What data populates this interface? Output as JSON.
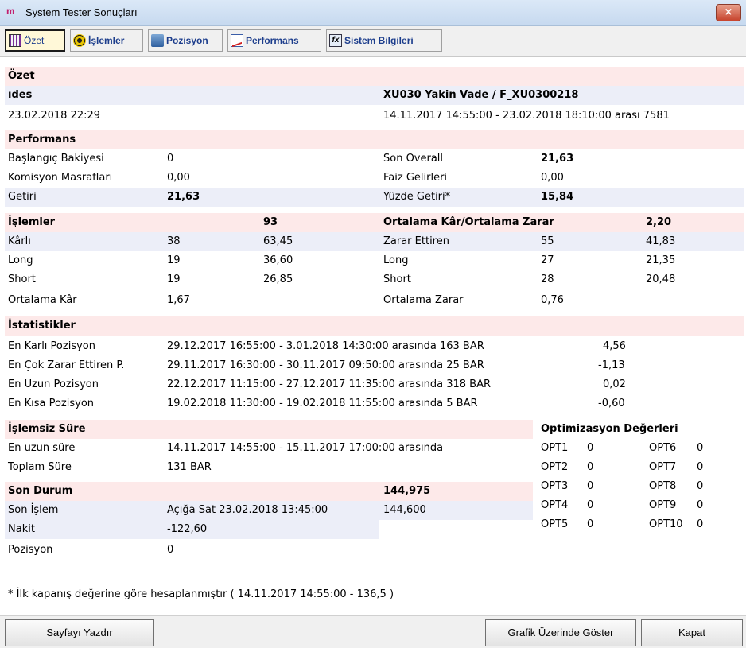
{
  "window": {
    "title": "System Tester Sonuçları",
    "close_label": "×",
    "app_icon_text": "m"
  },
  "tabs": [
    {
      "label": "Özet",
      "active": true
    },
    {
      "label": "İşlemler",
      "active": false
    },
    {
      "label": "Pozisyon",
      "active": false
    },
    {
      "label": "Performans",
      "active": false
    },
    {
      "label": "Sistem Bilgileri",
      "active": false
    }
  ],
  "summary": {
    "section_title": "Özet",
    "name": "ıdes",
    "symbol": "XU030 Yakin Vade / F_XU0300218",
    "date": "23.02.2018 22:29",
    "range": "14.11.2017 14:55:00 - 23.02.2018 18:10:00 arası 7581"
  },
  "performance": {
    "title": "Performans",
    "rows": [
      {
        "l1": "Başlangıç Bakiyesi",
        "v1": "0",
        "l2": "Son Overall",
        "v2": "21,63"
      },
      {
        "l1": "Komisyon Masrafları",
        "v1": "0,00",
        "l2": "Faiz Gelirleri",
        "v2": "0,00"
      },
      {
        "l1": "Getiri",
        "v1": "21,63",
        "l2": "Yüzde Getiri*",
        "v2": "15,84"
      }
    ]
  },
  "trades": {
    "title": "İşlemler",
    "total": "93",
    "ratio_label": "Ortalama Kâr/Ortalama Zarar",
    "ratio_value": "2,20",
    "rows": [
      {
        "l1": "Kârlı",
        "c1": "38",
        "p1": "63,45",
        "l2": "Zarar Ettiren",
        "c2": "55",
        "p2": "41,83"
      },
      {
        "l1": "Long",
        "c1": "19",
        "p1": "36,60",
        "l2": "Long",
        "c2": "27",
        "p2": "21,35"
      },
      {
        "l1": "Short",
        "c1": "19",
        "p1": "26,85",
        "l2": "Short",
        "c2": "28",
        "p2": "20,48"
      }
    ],
    "avg_profit_label": "Ortalama Kâr",
    "avg_profit": "1,67",
    "avg_loss_label": "Ortalama Zarar",
    "avg_loss": "0,76"
  },
  "stats": {
    "title": "İstatistikler",
    "rows": [
      {
        "label": "En Karlı Pozisyon",
        "range": "29.12.2017 16:55:00 - 3.01.2018 14:30:00 arasında 163 BAR",
        "value": "4,56"
      },
      {
        "label": "En Çok Zarar Ettiren P.",
        "range": "29.11.2017 16:30:00 - 30.11.2017 09:50:00 arasında 25 BAR",
        "value": "-1,13"
      },
      {
        "label": "En Uzun Pozisyon",
        "range": "22.12.2017 11:15:00 - 27.12.2017 11:35:00 arasında 318 BAR",
        "value": "0,02"
      },
      {
        "label": "En Kısa Pozisyon",
        "range": "19.02.2018 11:30:00 - 19.02.2018 11:55:00 arasında 5 BAR",
        "value": "-0,60"
      }
    ]
  },
  "idle": {
    "title": "İşlemsiz Süre",
    "longest_label": "En uzun süre",
    "longest": "14.11.2017 14:55:00 - 15.11.2017 17:00:00 arasında",
    "total_label": "Toplam Süre",
    "total": "131 BAR"
  },
  "status": {
    "title": "Son Durum",
    "value": "144,975",
    "last_trade_label": "Son İşlem",
    "last_trade": "Açığa Sat  23.02.2018 13:45:00",
    "last_trade_value": "144,600",
    "cash_label": "Nakit",
    "cash": "-122,60",
    "position_label": "Pozisyon",
    "position": "0"
  },
  "optimization": {
    "title": "Optimizasyon Değerleri",
    "left": [
      {
        "name": "OPT1",
        "value": "0"
      },
      {
        "name": "OPT2",
        "value": "0"
      },
      {
        "name": "OPT3",
        "value": "0"
      },
      {
        "name": "OPT4",
        "value": "0"
      },
      {
        "name": "OPT5",
        "value": "0"
      }
    ],
    "right": [
      {
        "name": "OPT6",
        "value": "0"
      },
      {
        "name": "OPT7",
        "value": "0"
      },
      {
        "name": "OPT8",
        "value": "0"
      },
      {
        "name": "OPT9",
        "value": "0"
      },
      {
        "name": "OPT10",
        "value": "0"
      }
    ]
  },
  "footnote": "* İlk kapanış değerine göre hesaplanmıştır ( 14.11.2017 14:55:00 - 136,5 )",
  "buttons": {
    "print": "Sayfayı Yazdır",
    "show_on_chart": "Grafik Üzerinde Göster",
    "close": "Kapat"
  }
}
